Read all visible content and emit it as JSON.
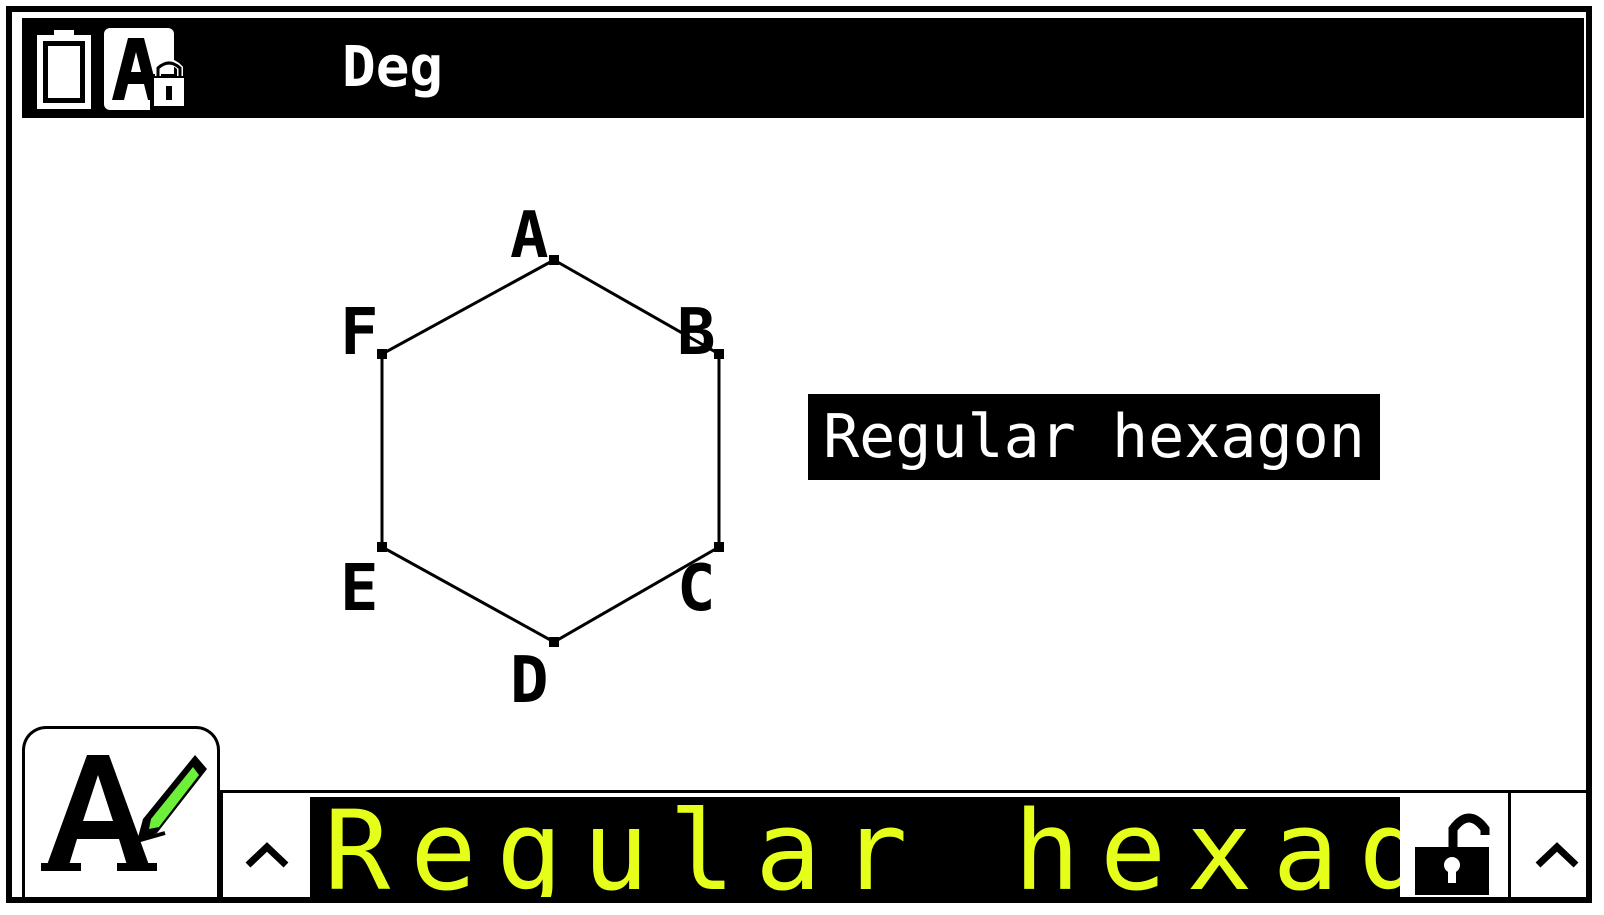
{
  "status": {
    "angle_mode": "Deg",
    "icons": [
      "battery-icon",
      "alpha-lock-icon"
    ]
  },
  "geometry": {
    "vertices": [
      "A",
      "B",
      "C",
      "D",
      "E",
      "F"
    ],
    "label_text": "Regular hexagon"
  },
  "input": {
    "text": "Regular hexago",
    "text_color": "#e6ff1a",
    "left_button_icon": "caret-up-icon",
    "lock_icon": "unlock-icon",
    "right_button_icon": "caret-up-icon",
    "tool_icon": "text-pen-icon"
  }
}
